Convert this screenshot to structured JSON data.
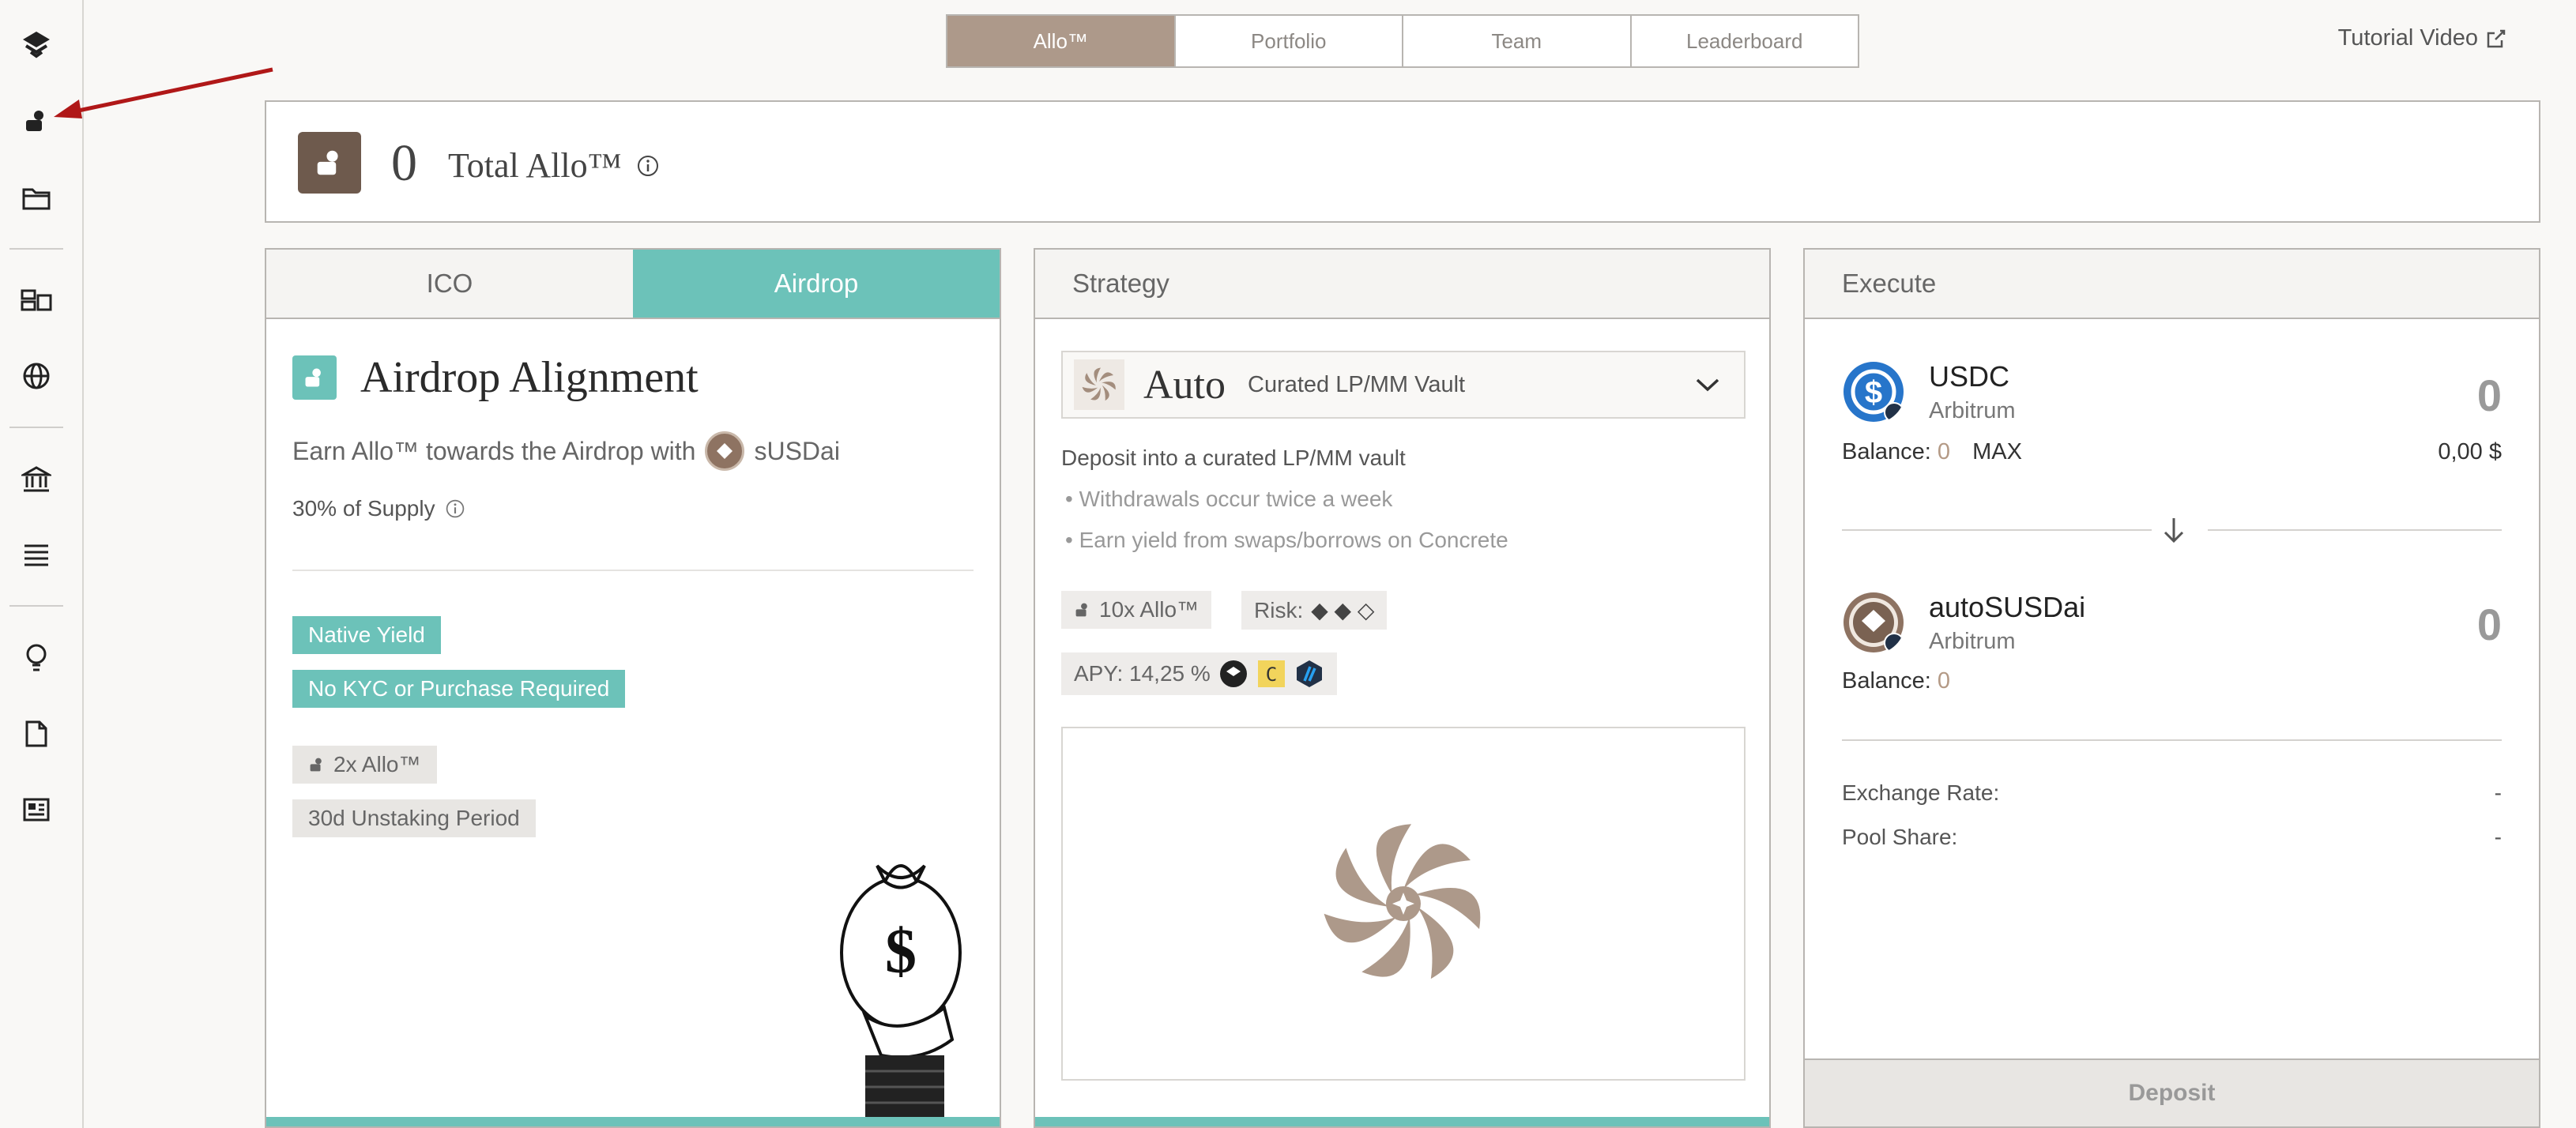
{
  "nav_tabs": [
    "Allo™",
    "Portfolio",
    "Team",
    "Leaderboard"
  ],
  "tutorial_label": "Tutorial Video",
  "total": {
    "value": "0",
    "label": "Total Allo™"
  },
  "card1": {
    "tabs": [
      "ICO",
      "Airdrop"
    ],
    "title": "Airdrop Alignment",
    "earn_text": "Earn Allo™ towards the Airdrop with",
    "token": "sUSDai",
    "supply": "30% of Supply",
    "tags_teal": [
      "Native Yield",
      "No KYC or Purchase Required"
    ],
    "tags_grey": [
      "2x Allo™",
      "30d Unstaking Period"
    ]
  },
  "card2": {
    "header": "Strategy",
    "dropdown_name": "Auto",
    "dropdown_sub": "Curated LP/MM Vault",
    "desc": "Deposit into a curated LP/MM vault",
    "bullets": [
      "Withdrawals occur twice a week",
      "Earn yield from swaps/borrows on Concrete"
    ],
    "multiplier": "10x Allo™",
    "risk_label": "Risk:",
    "risk_marks": "◆ ◆ ◇",
    "apy": "APY: 14,25 %"
  },
  "card3": {
    "header": "Execute",
    "from": {
      "name": "USDC",
      "chain": "Arbitrum",
      "amount": "0",
      "balance_label": "Balance:",
      "balance": "0",
      "max": "MAX",
      "usd": "0,00 $"
    },
    "to": {
      "name": "autoSUSDai",
      "chain": "Arbitrum",
      "amount": "0",
      "balance_label": "Balance:",
      "balance": "0"
    },
    "exchange_label": "Exchange Rate:",
    "exchange_value": "-",
    "pool_label": "Pool Share:",
    "pool_value": "-",
    "deposit": "Deposit"
  },
  "colors": {
    "teal": "#6cc2b9",
    "brown": "#6e5a4d",
    "tab_active": "#ad998a",
    "arrow": "#b01818"
  }
}
